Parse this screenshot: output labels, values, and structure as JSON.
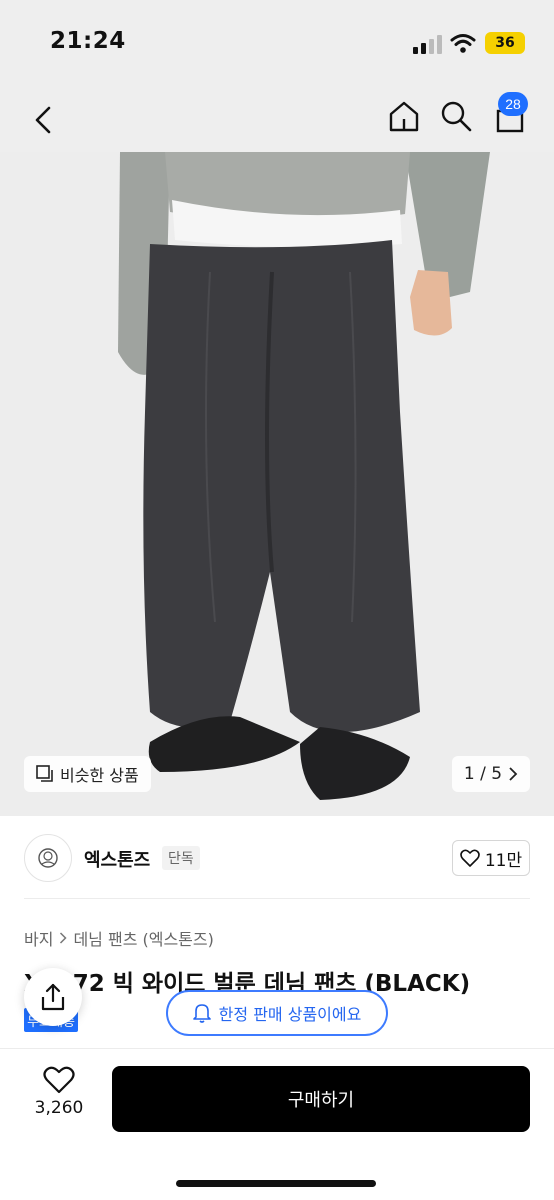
{
  "status": {
    "time": "21:24",
    "battery": "36"
  },
  "nav": {
    "cart_count": "28"
  },
  "gallery": {
    "similar_label": "비슷한 상품",
    "page_indicator": "1 / 5"
  },
  "brand": {
    "name": "엑스톤즈",
    "tag": "단독",
    "likes": "11만"
  },
  "breadcrumb": {
    "category": "바지",
    "subcategory": "데님 팬츠 (엑스톤즈)"
  },
  "product": {
    "title": "X… 72 빅 와이드 벌룬 데님 팬츠 (BLACK)",
    "badge": "무료배송"
  },
  "toast": {
    "limited_label": "한정 판매 상품이에요"
  },
  "bottom": {
    "wish_count": "3,260",
    "buy_label": "구매하기"
  },
  "colors": {
    "accent_blue": "#1f6fff",
    "buy_button": "#000000",
    "battery": "#f5d000"
  }
}
